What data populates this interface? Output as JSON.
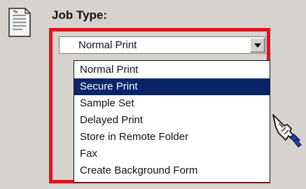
{
  "job_type": {
    "label": "Job Type:",
    "selected_value": "Normal Print",
    "options": [
      "Normal Print",
      "Secure Print",
      "Sample Set",
      "Delayed Print",
      "Store in Remote Folder",
      "Fax",
      "Create Background Form"
    ],
    "highlighted_option": "Secure Print"
  },
  "icons": {
    "document": "document-icon",
    "dropdown": "chevron-down-icon",
    "pointer": "pointing-hand-icon"
  },
  "colors": {
    "highlight_frame": "#e8101a",
    "selection_background": "#0a246a",
    "panel_background": "#d6d3ce"
  }
}
